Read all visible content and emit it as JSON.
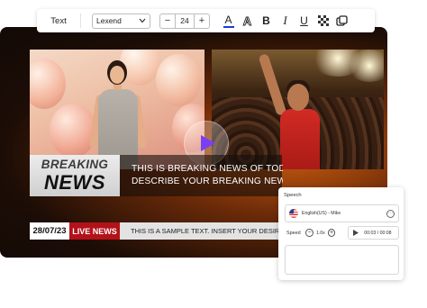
{
  "toolbar": {
    "title": "Text",
    "font_family": "Lexend",
    "font_size": "24",
    "decrease_label": "−",
    "increase_label": "+",
    "bold_label": "B",
    "italic_label": "I",
    "underline_label": "U",
    "color_label": "A",
    "outline_label": "A",
    "text_color": "#1d3bdb",
    "icons": [
      "text-color-icon",
      "text-outline-icon",
      "bold-icon",
      "italic-icon",
      "underline-icon",
      "transparency-icon",
      "layers-icon"
    ]
  },
  "news": {
    "logo_line1": "BREAKING",
    "logo_line2": "NEWS",
    "headline_line1": "THIS IS BREAKING NEWS OF TODAY",
    "headline_line2": "DESCRIBE YOUR BREAKING NEWS IN",
    "date": "28/07/23",
    "live_label": "LIVE NEWS",
    "ticker_text": "THIS IS A SAMPLE TEXT. INSERT YOUR DESIRED",
    "live_color": "#b3121a"
  },
  "speech": {
    "title": "Speech",
    "voice": "English(US) - Mike",
    "speed_label": "Speed",
    "speed_value": "1.0x",
    "minus_label": "−",
    "plus_label": "+",
    "time": "00:03 / 00:08",
    "more_label": "···"
  },
  "colors": {
    "accent_play": "#7b3ff2"
  }
}
